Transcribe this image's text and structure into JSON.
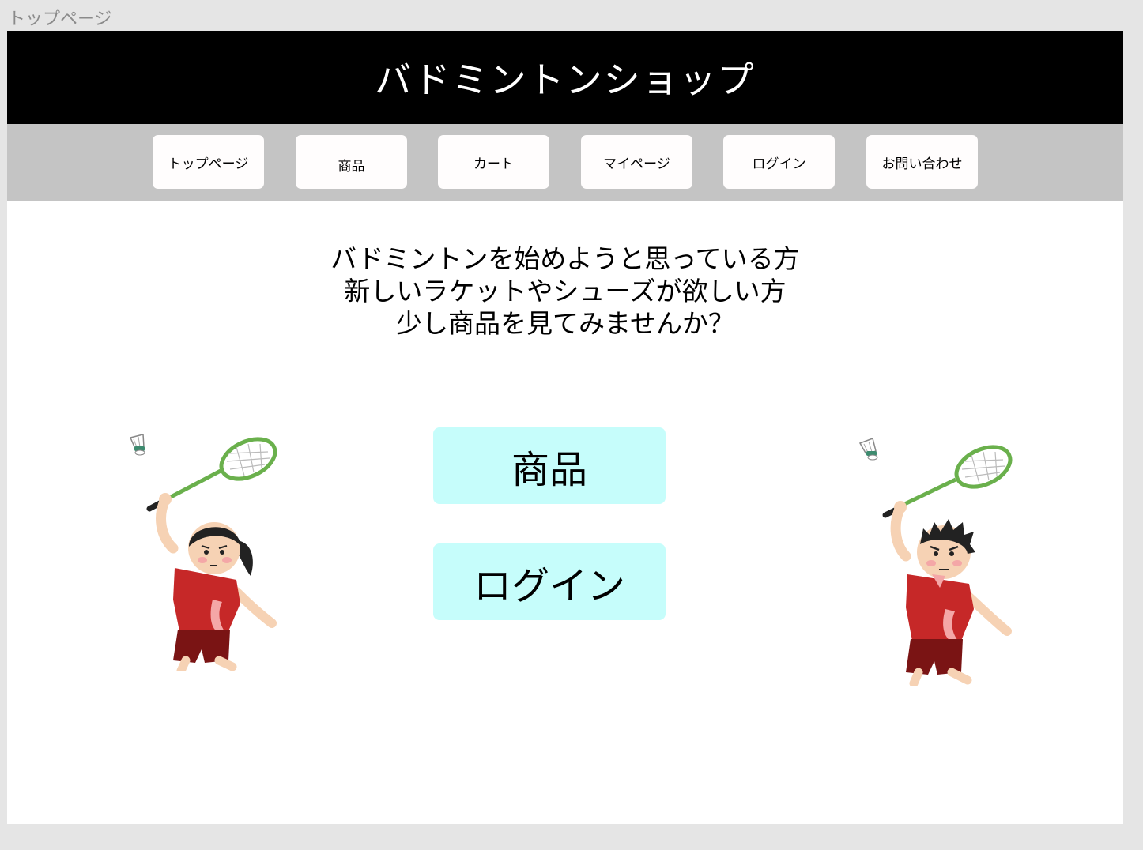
{
  "frame": {
    "label": "トップページ"
  },
  "header": {
    "title": "バドミントンショップ"
  },
  "nav": {
    "items": [
      {
        "label": "トップページ"
      },
      {
        "label": "商品"
      },
      {
        "label": "カート"
      },
      {
        "label": "マイページ"
      },
      {
        "label": "ログイン"
      },
      {
        "label": "お問い合わせ"
      }
    ]
  },
  "main": {
    "intro_lines": [
      "バドミントンを始めようと思っている方",
      "新しいラケットやシューズが欲しい方",
      "少し商品を見てみませんか？"
    ],
    "products_button": "商品",
    "login_button": "ログイン"
  },
  "colors": {
    "header_bg": "#000000",
    "nav_bg": "#c4c4c4",
    "cta_bg": "#c6fdfb",
    "shirt": "#c62828",
    "racket": "#6ab04c"
  },
  "illustrations": [
    "female-badminton-player",
    "male-badminton-player"
  ]
}
